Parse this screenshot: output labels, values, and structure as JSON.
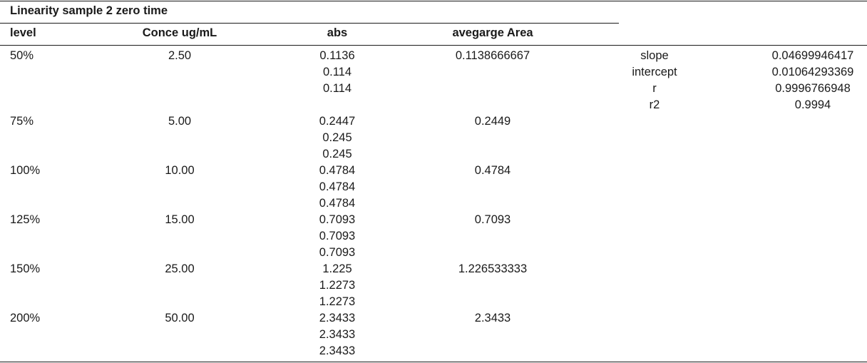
{
  "title": "Linearity sample 2 zero time",
  "columns": {
    "level": "level",
    "conce": "Conce ug/mL",
    "abs": "abs",
    "avg": "avegarge Area"
  },
  "rows": [
    {
      "level": "50%",
      "conce": "2.50",
      "abs": [
        "0.1136",
        "0.114",
        "0.114"
      ],
      "avg": "0.1138666667"
    },
    {
      "level": "75%",
      "conce": "5.00",
      "abs": [
        "0.2447",
        "0.245",
        "0.245"
      ],
      "avg": "0.2449"
    },
    {
      "level": "100%",
      "conce": "10.00",
      "abs": [
        "0.4784",
        "0.4784",
        "0.4784"
      ],
      "avg": "0.4784"
    },
    {
      "level": "125%",
      "conce": "15.00",
      "abs": [
        "0.7093",
        "0.7093",
        "0.7093"
      ],
      "avg": "0.7093"
    },
    {
      "level": "150%",
      "conce": "25.00",
      "abs": [
        "1.225",
        "1.2273",
        "1.2273"
      ],
      "avg": "1.226533333"
    },
    {
      "level": "200%",
      "conce": "50.00",
      "abs": [
        "2.3433",
        "2.3433",
        "2.3433"
      ],
      "avg": "2.3433"
    }
  ],
  "stats": [
    {
      "label": "slope",
      "value": "0.04699946417"
    },
    {
      "label": "intercept",
      "value": "0.01064293369"
    },
    {
      "label": "r",
      "value": "0.9996766948"
    },
    {
      "label": "r2",
      "value": "0.9994"
    }
  ]
}
